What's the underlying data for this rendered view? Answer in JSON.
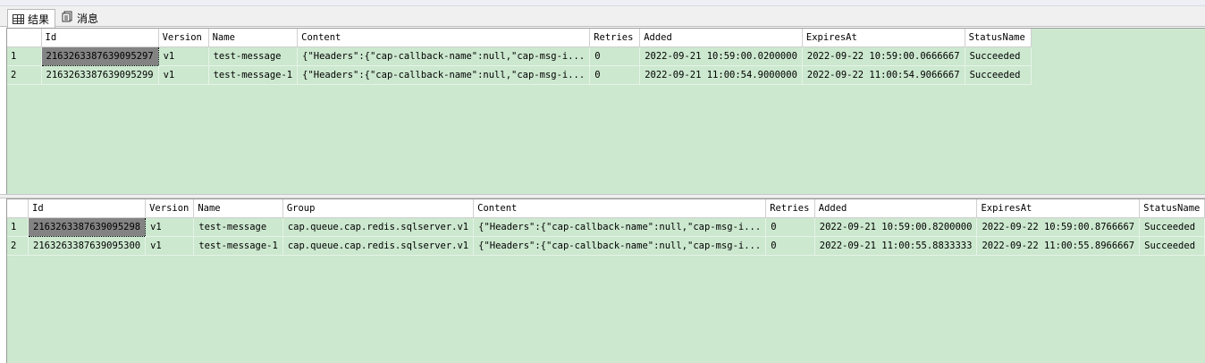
{
  "tabs": [
    {
      "label": "结果",
      "icon": "grid-icon"
    },
    {
      "label": "消息",
      "icon": "message-icon"
    }
  ],
  "grid1": {
    "columns": [
      "",
      "Id",
      "Version",
      "Name",
      "Content",
      "Retries",
      "Added",
      "ExpiresAt",
      "StatusName"
    ],
    "rows": [
      [
        "1",
        "2163263387639095297",
        "v1",
        "test-message",
        "{\"Headers\":{\"cap-callback-name\":null,\"cap-msg-i...",
        "0",
        "2022-09-21 10:59:00.0200000",
        "2022-09-22 10:59:00.0666667",
        "Succeeded"
      ],
      [
        "2",
        "2163263387639095299",
        "v1",
        "test-message-1",
        "{\"Headers\":{\"cap-callback-name\":null,\"cap-msg-i...",
        "0",
        "2022-09-21 11:00:54.9000000",
        "2022-09-22 11:00:54.9066667",
        "Succeeded"
      ]
    ]
  },
  "grid2": {
    "columns": [
      "",
      "Id",
      "Version",
      "Name",
      "Group",
      "Content",
      "Retries",
      "Added",
      "ExpiresAt",
      "StatusName"
    ],
    "rows": [
      [
        "1",
        "2163263387639095298",
        "v1",
        "test-message",
        "cap.queue.cap.redis.sqlserver.v1",
        "{\"Headers\":{\"cap-callback-name\":null,\"cap-msg-i...",
        "0",
        "2022-09-21 10:59:00.8200000",
        "2022-09-22 10:59:00.8766667",
        "Succeeded"
      ],
      [
        "2",
        "2163263387639095300",
        "v1",
        "test-message-1",
        "cap.queue.cap.redis.sqlserver.v1",
        "{\"Headers\":{\"cap-callback-name\":null,\"cap-msg-i...",
        "0",
        "2022-09-21 11:00:55.8833333",
        "2022-09-22 11:00:55.8966667",
        "Succeeded"
      ]
    ]
  },
  "colors": {
    "grid_background": "#cce8cf",
    "selected_cell": "#838383"
  }
}
